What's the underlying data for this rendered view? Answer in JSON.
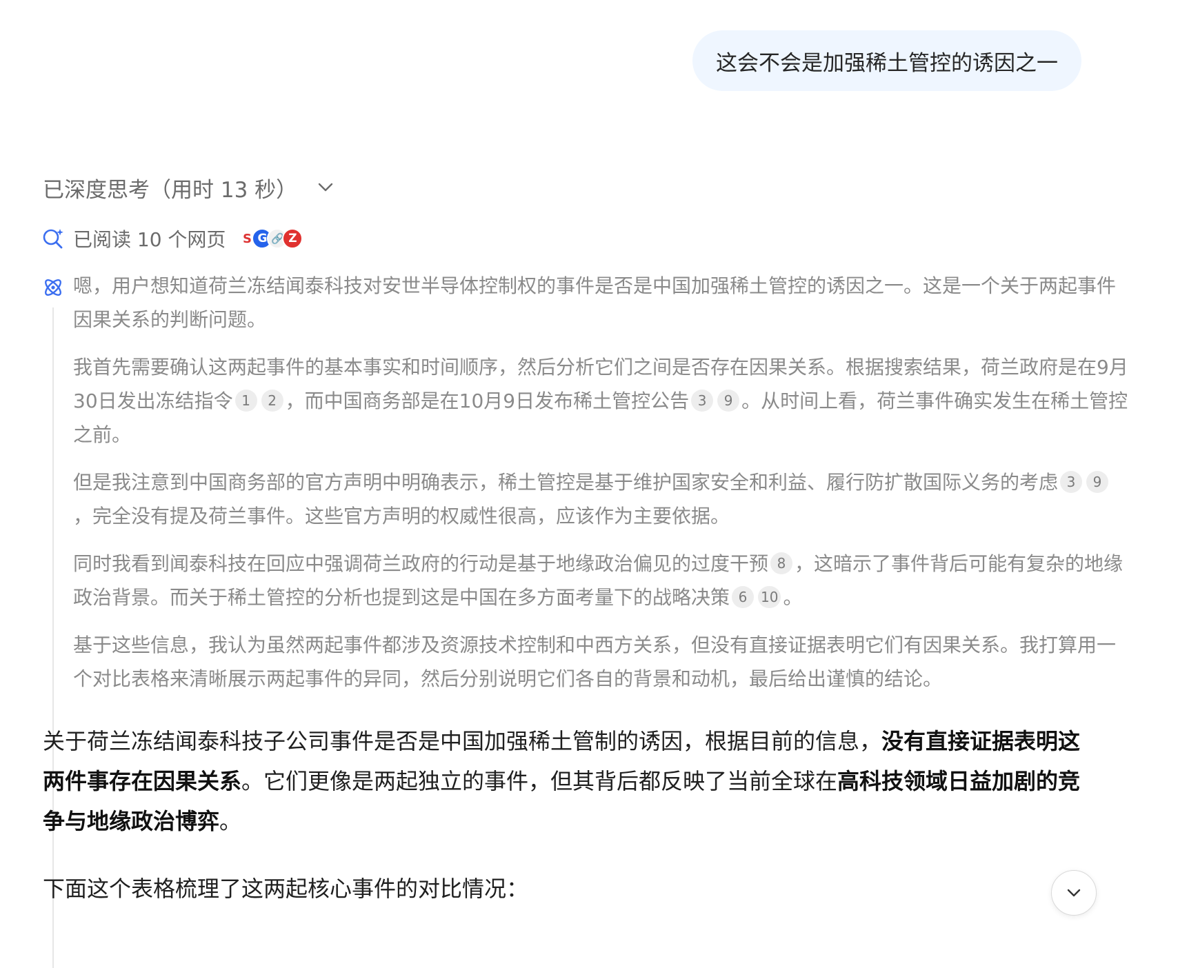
{
  "user_message": "这会不会是加强稀土管控的诱因之一",
  "thinking": {
    "header": "已深度思考（用时 13 秒）",
    "read_label": "已阅读 10 个网页",
    "sources": [
      {
        "name": "source-1",
        "glyph": "S"
      },
      {
        "name": "source-2",
        "glyph": "G"
      },
      {
        "name": "source-3",
        "glyph": "🔗"
      },
      {
        "name": "source-4",
        "glyph": "Z"
      }
    ],
    "paragraphs": [
      {
        "segments": [
          {
            "text": "嗯，用户想知道荷兰冻结闻泰科技对安世半导体控制权的事件是否是中国加强稀土管控的诱因之一。这是一个关于两起事件因果关系的判断问题。"
          }
        ]
      },
      {
        "segments": [
          {
            "text": "我首先需要确认这两起事件的基本事实和时间顺序，然后分析它们之间是否存在因果关系。根据搜索结果，荷兰政府是在9月30日发出冻结指令"
          },
          {
            "cite": "1"
          },
          {
            "cite": "2"
          },
          {
            "text": "，而中国商务部是在10月9日发布稀土管控公告"
          },
          {
            "cite": "3"
          },
          {
            "cite": "9"
          },
          {
            "text": "。从时间上看，荷兰事件确实发生在稀土管控之前。"
          }
        ]
      },
      {
        "segments": [
          {
            "text": "但是我注意到中国商务部的官方声明中明确表示，稀土管控是基于维护国家安全和利益、履行防扩散国际义务的考虑"
          },
          {
            "cite": "3"
          },
          {
            "cite": "9"
          },
          {
            "text": "，完全没有提及荷兰事件。这些官方声明的权威性很高，应该作为主要依据。"
          }
        ]
      },
      {
        "segments": [
          {
            "text": "同时我看到闻泰科技在回应中强调荷兰政府的行动是基于地缘政治偏见的过度干预"
          },
          {
            "cite": "8"
          },
          {
            "text": "，这暗示了事件背后可能有复杂的地缘政治背景。而关于稀土管控的分析也提到这是中国在多方面考量下的战略决策"
          },
          {
            "cite": "6"
          },
          {
            "cite": "10"
          },
          {
            "text": "。"
          }
        ]
      },
      {
        "segments": [
          {
            "text": "基于这些信息，我认为虽然两起事件都涉及资源技术控制和中西方关系，但没有直接证据表明它们有因果关系。我打算用一个对比表格来清晰展示两起事件的异同，然后分别说明它们各自的背景和动机，最后给出谨慎的结论。"
          }
        ]
      }
    ]
  },
  "answer": {
    "paragraph": [
      {
        "text": "关于荷兰冻结闻泰科技子公司事件是否是中国加强稀土管制的诱因，根据目前的信息，"
      },
      {
        "text": "没有直接证据表明这两件事存在因果关系",
        "bold": true
      },
      {
        "text": "。它们更像是两起独立的事件，但其背后都反映了当前全球在"
      },
      {
        "text": "高科技领域日益加剧的竞争与地缘政治博弈",
        "bold": true
      },
      {
        "text": "。"
      }
    ],
    "table_intro": "下面这个表格梳理了这两起核心事件的对比情况："
  },
  "colors": {
    "user_bubble": "#eff6ff",
    "accent_blue": "#2563eb",
    "thinking_text": "#8a8a8a"
  }
}
